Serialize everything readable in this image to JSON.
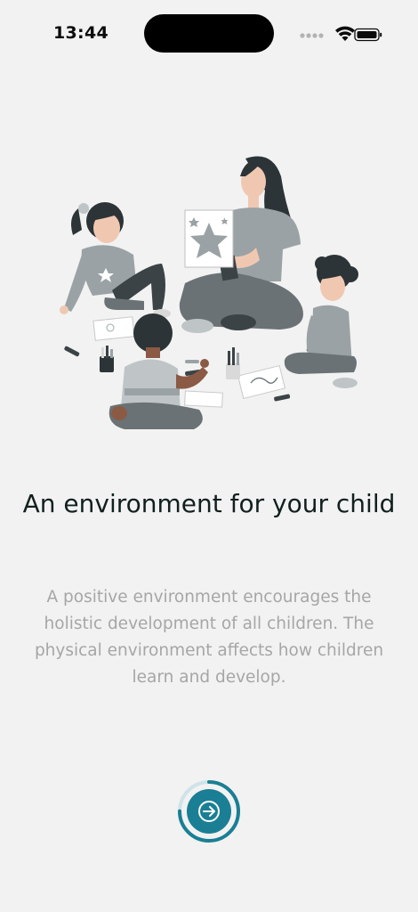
{
  "status_bar": {
    "time": "13:44",
    "icons": [
      "signal-dots-icon",
      "wifi-icon",
      "battery-icon"
    ]
  },
  "onboarding": {
    "title": "An environment for your child",
    "description": "A positive environment encourages the holistic development of all children. The physical environment affects how children learn and develop.",
    "progress": 0.75,
    "next_icon": "arrow-right-icon"
  },
  "colors": {
    "background": "#f2f2f2",
    "title": "#11201e",
    "description": "#a6a6a6",
    "accent": "#1a7f94"
  }
}
